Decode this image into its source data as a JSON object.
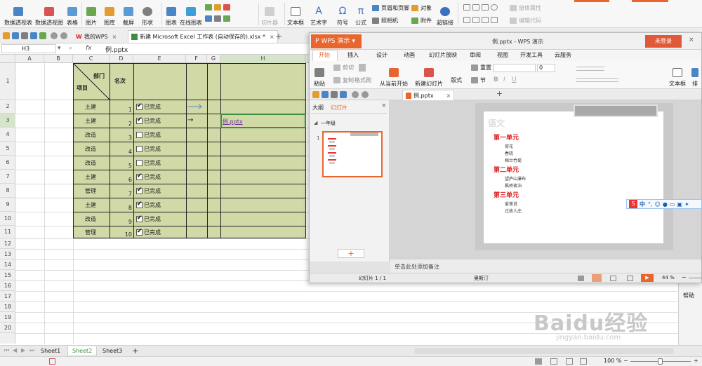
{
  "ribbon": {
    "buttons": [
      "数据透视表",
      "数据透视图",
      "表格",
      "图片",
      "图库",
      "截屏",
      "形状",
      "图表",
      "在线图表",
      "切片器",
      "文本框",
      "艺术字",
      "符号",
      "公式",
      "超链接"
    ],
    "small_items": [
      "页眉和页脚",
      "对象",
      "照相机",
      "附件",
      "窗体属性",
      "编辑代码"
    ]
  },
  "doc_tabs": {
    "tab1": "我的WPS",
    "tab2": "新建 Microsoft Excel 工作表 (自动保存的).xlsx *"
  },
  "formula_bar": {
    "cell_ref": "H3",
    "fx": "fx",
    "content": "例.pptx"
  },
  "columns": [
    "A",
    "B",
    "C",
    "D",
    "E",
    "F",
    "G",
    "H"
  ],
  "rows": [
    "1",
    "2",
    "3",
    "4",
    "5",
    "6",
    "7",
    "8",
    "9",
    "10",
    "11",
    "12",
    "13",
    "14",
    "15",
    "16",
    "17",
    "18",
    "19",
    "20"
  ],
  "table": {
    "header_dept": "部门",
    "header_item": "项目",
    "header_order": "名次",
    "rows": [
      {
        "dept": "土建",
        "n": "1",
        "status": "已完成",
        "checked": true
      },
      {
        "dept": "土建",
        "n": "2",
        "status": "已完成",
        "checked": true
      },
      {
        "dept": "改造",
        "n": "3",
        "status": "已完成",
        "checked": false
      },
      {
        "dept": "改造",
        "n": "4",
        "status": "已完成",
        "checked": false
      },
      {
        "dept": "改造",
        "n": "5",
        "status": "已完成",
        "checked": false
      },
      {
        "dept": "土建",
        "n": "6",
        "status": "已完成",
        "checked": true
      },
      {
        "dept": "管理",
        "n": "7",
        "status": "已完成",
        "checked": true
      },
      {
        "dept": "土建",
        "n": "8",
        "status": "已完成",
        "checked": true
      },
      {
        "dept": "改造",
        "n": "9",
        "status": "已完成",
        "checked": true
      },
      {
        "dept": "管理",
        "n": "10",
        "status": "已完成",
        "checked": true
      }
    ],
    "arrow_row3": "→",
    "link_text": "例.pptx"
  },
  "sheets": [
    "Sheet1",
    "Sheet2",
    "Sheet3"
  ],
  "add_sheet": "+",
  "zoom_excel": "100 %",
  "wps": {
    "brand": "WPS 演示",
    "title": "例.pptx - WPS 演示",
    "login": "未登录",
    "menu": [
      "开始",
      "插入",
      "设计",
      "动画",
      "幻灯片放映",
      "审阅",
      "视图",
      "开发工具",
      "云服务"
    ],
    "tool_labels": [
      "粘贴",
      "剪切",
      "复制",
      "格式刷",
      "从当前开始",
      "新建幻灯片",
      "版式",
      "重置",
      "节",
      "文本框",
      "排"
    ],
    "font_size": "0",
    "file_tab": "例.pptx",
    "panel_tabs": [
      "大纲",
      "幻灯片"
    ],
    "section": "一年级",
    "slide_num": "1",
    "slide_title": "语文",
    "units": [
      {
        "title": "第一单元",
        "items": [
          "荷花",
          "春晓",
          "梅兰竹菊"
        ]
      },
      {
        "title": "第二单元",
        "items": [
          "望庐山瀑布",
          "枫桥夜泊"
        ]
      },
      {
        "title": "第三单元",
        "items": [
          "爱莲说",
          "过故人庄"
        ]
      }
    ],
    "notes_placeholder": "单击此处添加备注",
    "status_slide": "幻灯片 1 / 1",
    "status_theme": "奥斯汀",
    "zoom": "44 %",
    "add_btn": "+"
  },
  "ime": {
    "lang": "中"
  },
  "help": "帮助",
  "watermark": {
    "main": "Baidu经验",
    "sub": "jingyan.baidu.com"
  },
  "colors": {
    "table_fill": "#d1d9a7",
    "wps_orange": "#e8662e",
    "login_red": "#e05a3a",
    "link": "#7030a0",
    "selected_border": "#3e8e3e"
  }
}
